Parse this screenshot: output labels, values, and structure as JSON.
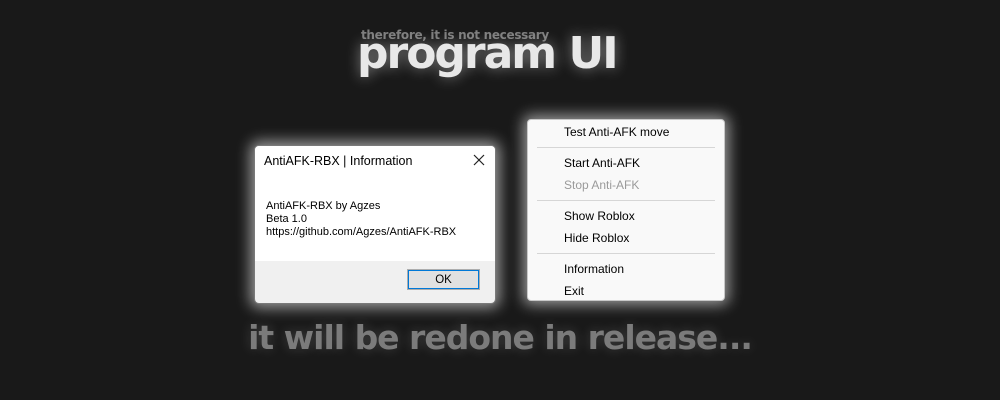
{
  "banner": {
    "subtitle": "therefore, it is not necessary",
    "title": "program UI",
    "footer": "it will be redone in release..."
  },
  "dialog": {
    "title": "AntiAFK-RBX | Information",
    "close_icon": "close-icon",
    "lines": [
      "AntiAFK-RBX by Agzes",
      "Beta 1.0",
      "https://github.com/Agzes/AntiAFK-RBX"
    ],
    "ok_label": "OK"
  },
  "menu": {
    "items": [
      {
        "label": "Test Anti-AFK move",
        "enabled": true
      },
      {
        "label": "Start Anti-AFK",
        "enabled": true
      },
      {
        "label": "Stop Anti-AFK",
        "enabled": false
      },
      {
        "label": "Show Roblox",
        "enabled": true
      },
      {
        "label": "Hide Roblox",
        "enabled": true
      },
      {
        "label": "Information",
        "enabled": true
      },
      {
        "label": "Exit",
        "enabled": true
      }
    ]
  }
}
